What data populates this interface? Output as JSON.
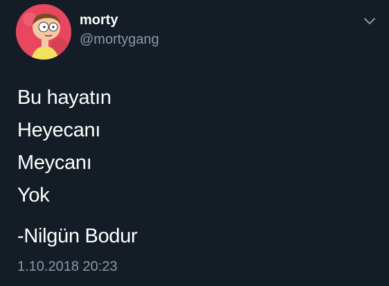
{
  "user": {
    "display_name": "morty",
    "handle": "@mortygang",
    "avatar_icon": "morty-avatar-icon"
  },
  "menu": {
    "icon": "chevron-down-icon"
  },
  "tweet": {
    "lines": [
      "Bu hayatın",
      "Heyecanı",
      "Meycanı",
      "Yok"
    ],
    "signature": "-Nilgün Bodur",
    "timestamp": "1.10.2018 20:23"
  },
  "colors": {
    "background": "#141d26",
    "text_primary": "#ffffff",
    "text_secondary": "#8899a6",
    "avatar_bg": "#e8475f"
  }
}
